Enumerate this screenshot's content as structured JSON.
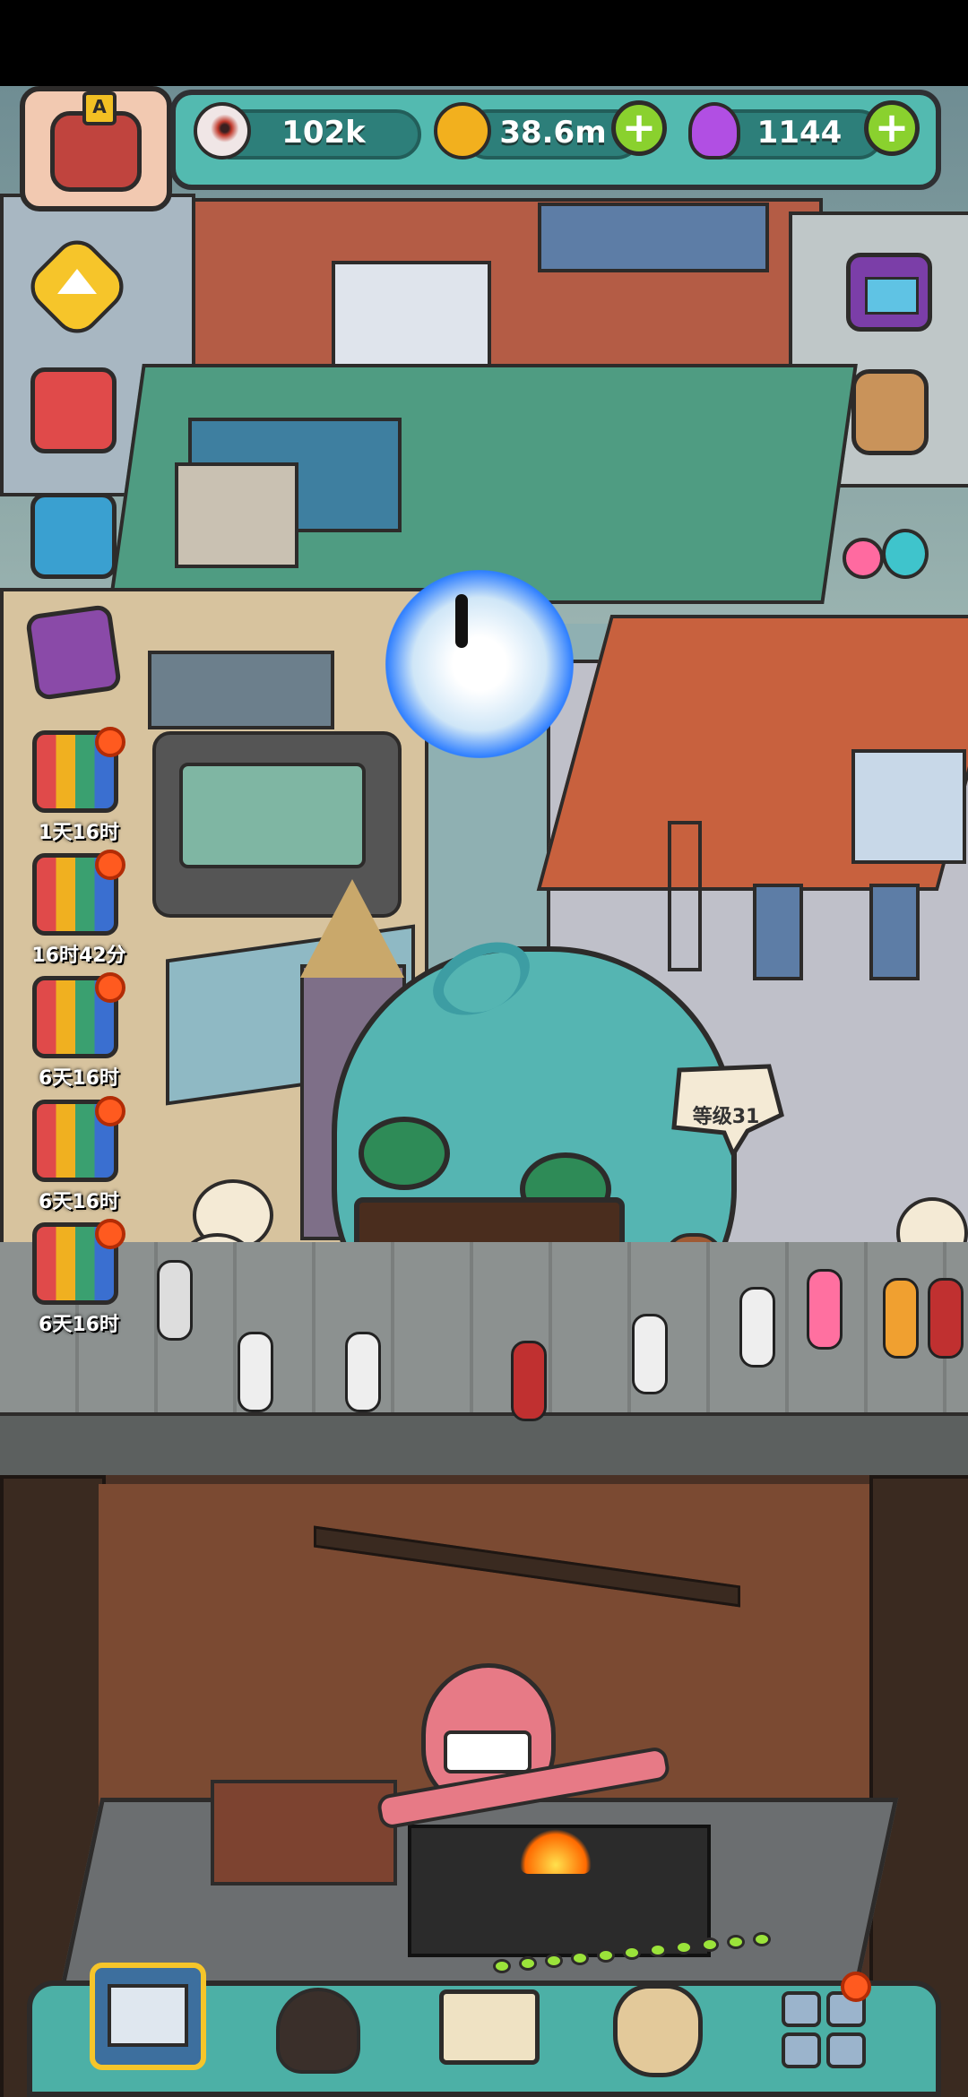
{
  "resources": {
    "eyes": {
      "value": "102k",
      "icon": "eyeball-icon"
    },
    "coins": {
      "value": "38.6m",
      "icon": "coin-icon"
    },
    "potions": {
      "value": "1144",
      "icon": "potion-icon"
    }
  },
  "restaurant": {
    "level_label": "等级31"
  },
  "side_gifts": [
    {
      "timer": "1天16时"
    },
    {
      "timer": "16时42分"
    },
    {
      "timer": "6天16时"
    },
    {
      "timer": "6天16时"
    },
    {
      "timer": "6天16时"
    }
  ],
  "bottom_nav": [
    {
      "name": "restaurant",
      "icon": "shop-icon",
      "selected": true
    },
    {
      "name": "monster",
      "icon": "monster-icon",
      "selected": false
    },
    {
      "name": "recipe-book",
      "icon": "book-icon",
      "selected": false
    },
    {
      "name": "bag",
      "icon": "money-bag-icon",
      "selected": false
    },
    {
      "name": "more",
      "icon": "grid-icon",
      "selected": false,
      "badge": true
    }
  ],
  "colors": {
    "accent": "#53bab0",
    "plus_button": "#8ad12e",
    "badge": "#ff5a1f"
  }
}
